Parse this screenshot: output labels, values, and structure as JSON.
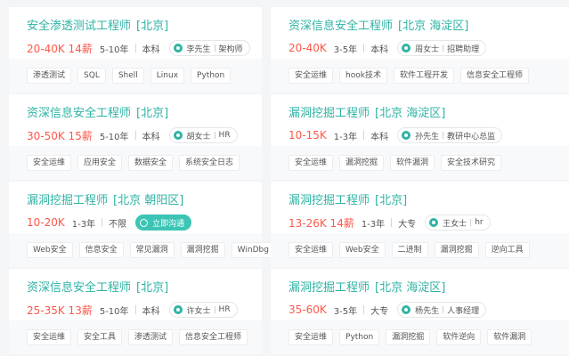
{
  "jobs": [
    {
      "title": "安全渗透测试工程师",
      "location": "[北京]",
      "salary": "20-40K 14薪",
      "experience": "5-10年",
      "education": "本科",
      "recruiter_name": "李先生",
      "recruiter_role": "架构师",
      "chat_label": "",
      "tags": [
        "渗透测试",
        "SQL",
        "Shell",
        "Linux",
        "Python"
      ]
    },
    {
      "title": "资深信息安全工程师",
      "location": "[北京 海淀区]",
      "salary": "20-40K",
      "experience": "3-5年",
      "education": "本科",
      "recruiter_name": "周女士",
      "recruiter_role": "招聘助理",
      "chat_label": "",
      "tags": [
        "安全运维",
        "hook技术",
        "软件工程开发",
        "信息安全工程师"
      ]
    },
    {
      "title": "资深信息安全工程师",
      "location": "[北京]",
      "salary": "30-50K 15薪",
      "experience": "5-10年",
      "education": "本科",
      "recruiter_name": "胡女士",
      "recruiter_role": "HR",
      "chat_label": "",
      "tags": [
        "安全运维",
        "应用安全",
        "数据安全",
        "系统安全日志"
      ]
    },
    {
      "title": "漏洞挖掘工程师",
      "location": "[北京 海淀区]",
      "salary": "10-15K",
      "experience": "1-3年",
      "education": "本科",
      "recruiter_name": "孙先生",
      "recruiter_role": "教研中心总监",
      "chat_label": "",
      "tags": [
        "安全运维",
        "漏洞挖掘",
        "软件漏洞",
        "安全技术研究"
      ]
    },
    {
      "title": "漏洞挖掘工程师",
      "location": "[北京 朝阳区]",
      "salary": "10-20K",
      "experience": "1-3年",
      "education": "不限",
      "recruiter_name": "",
      "recruiter_role": "",
      "chat_label": "立即沟通",
      "tags": [
        "Web安全",
        "信息安全",
        "常见漏洞",
        "漏洞挖掘",
        "WinDbg"
      ]
    },
    {
      "title": "漏洞挖掘工程师",
      "location": "[北京]",
      "salary": "13-26K 14薪",
      "experience": "1-3年",
      "education": "大专",
      "recruiter_name": "王女士",
      "recruiter_role": "hr",
      "chat_label": "",
      "tags": [
        "安全运维",
        "Web安全",
        "二进制",
        "漏洞挖掘",
        "逆向工具"
      ]
    },
    {
      "title": "资深信息安全工程师",
      "location": "[北京]",
      "salary": "25-35K 13薪",
      "experience": "5-10年",
      "education": "本科",
      "recruiter_name": "许女士",
      "recruiter_role": "HR",
      "chat_label": "",
      "tags": [
        "安全运维",
        "安全工具",
        "渗透测试",
        "信息安全工程师"
      ]
    },
    {
      "title": "漏洞挖掘工程师",
      "location": "[北京 海淀区]",
      "salary": "35-60K",
      "experience": "3-5年",
      "education": "大专",
      "recruiter_name": "杨先生",
      "recruiter_role": "人事经理",
      "chat_label": "",
      "tags": [
        "安全运维",
        "Python",
        "漏洞挖掘",
        "软件逆向",
        "软件漏洞"
      ]
    }
  ],
  "colors": {
    "accent": "#2fb3a4",
    "salary": "#fe574a",
    "chat_button": "#3cc5b5"
  },
  "icons": {
    "recruiter_avatar": "avatar-icon",
    "chat": "chat-icon"
  }
}
